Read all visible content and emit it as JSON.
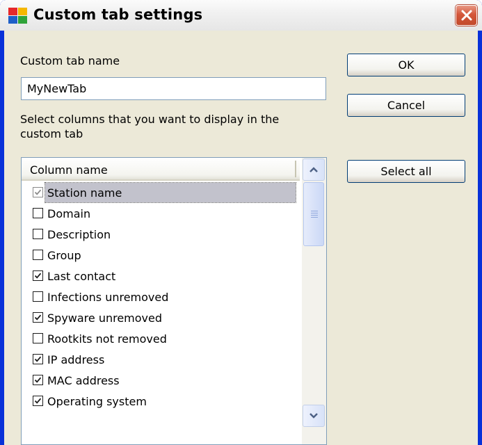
{
  "window": {
    "title": "Custom tab settings",
    "icon": "avg-app-icon",
    "close_icon": "close-icon"
  },
  "form": {
    "tab_name_label": "Custom tab name",
    "tab_name_value": "MyNewTab",
    "instructions_line1": "Select columns that you want to display in the",
    "instructions_line2": "custom tab"
  },
  "buttons": {
    "ok": "OK",
    "cancel": "Cancel",
    "select_all": "Select all"
  },
  "list": {
    "header": "Column name",
    "items": [
      {
        "label": "Station name",
        "checked": true,
        "selected": true,
        "disabled": true
      },
      {
        "label": "Domain",
        "checked": false
      },
      {
        "label": "Description",
        "checked": false
      },
      {
        "label": "Group",
        "checked": false
      },
      {
        "label": "Last contact",
        "checked": true
      },
      {
        "label": "Infections unremoved",
        "checked": false
      },
      {
        "label": "Spyware unremoved",
        "checked": true
      },
      {
        "label": "Rootkits not removed",
        "checked": false
      },
      {
        "label": "IP address",
        "checked": true
      },
      {
        "label": "MAC address",
        "checked": true
      },
      {
        "label": "Operating system",
        "checked": true
      }
    ]
  },
  "colors": {
    "dialog_bg": "#ece9d8",
    "selection": "#c2c2cc",
    "input_border": "#7f9db9",
    "button_border": "#003c74"
  }
}
